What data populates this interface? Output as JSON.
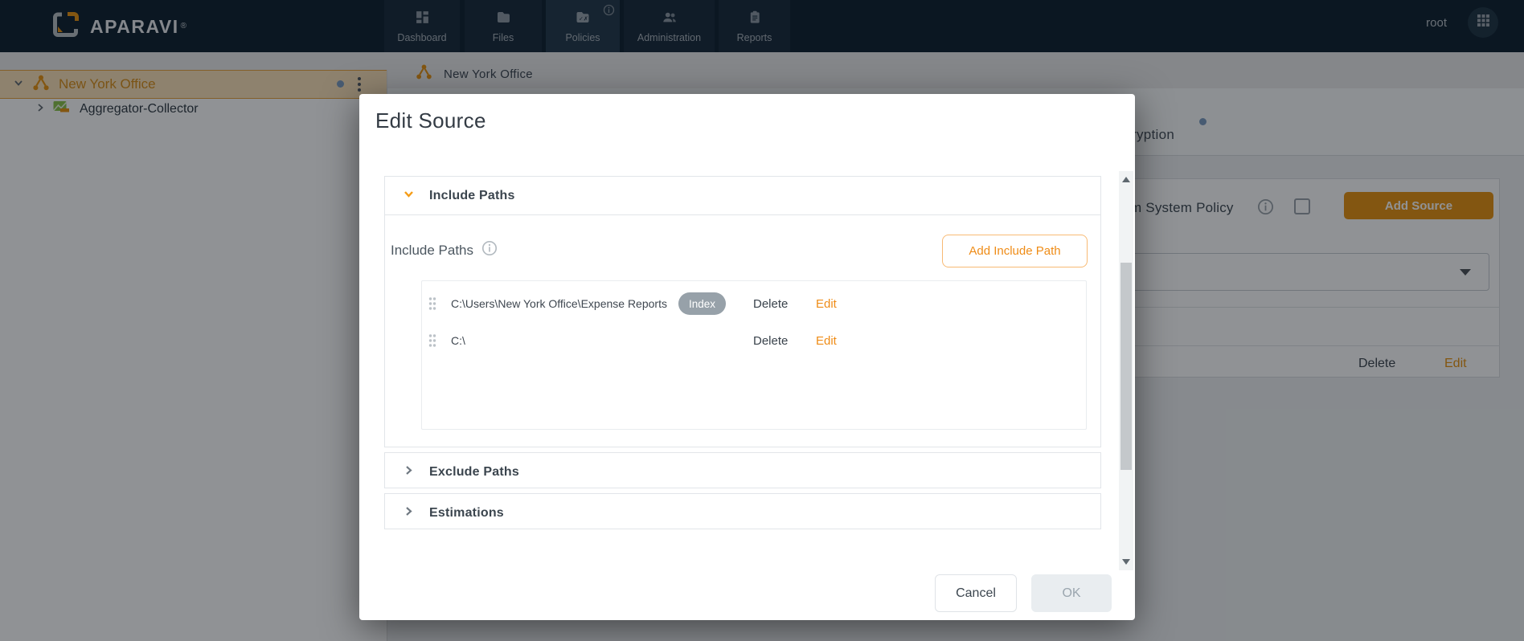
{
  "brand": {
    "wordmark": "APARAVI",
    "registered": "®"
  },
  "navbar": {
    "items": [
      {
        "label": "Dashboard",
        "icon": "dashboard-icon",
        "active": false
      },
      {
        "label": "Files",
        "icon": "folder-icon",
        "active": false
      },
      {
        "label": "Policies",
        "icon": "policies-folder-icon",
        "active": true,
        "has_info_icon": true
      },
      {
        "label": "Administration",
        "icon": "people-icon",
        "active": false
      },
      {
        "label": "Reports",
        "icon": "clipboard-icon",
        "active": false
      }
    ],
    "username": "root"
  },
  "sidebar": {
    "selected_node": {
      "label": "New York Office",
      "expanded": true,
      "has_status_dot": true
    },
    "child_node": {
      "label": "Aggregator-Collector",
      "expanded": false
    }
  },
  "breadcrumb": {
    "label": "New York Office"
  },
  "background_page": {
    "tab_label_partial": "ryption",
    "policy_label_partial": "m System Policy",
    "add_source_button": "Add Source",
    "row_actions": {
      "delete": "Delete",
      "edit": "Edit"
    }
  },
  "modal": {
    "title": "Edit Source",
    "include_section": {
      "header": "Include Paths",
      "field_label": "Include Paths",
      "add_button": "Add Include Path",
      "rows": [
        {
          "path": "C:\\Users\\New York Office\\Expense Reports",
          "badge": "Index",
          "delete_label": "Delete",
          "edit_label": "Edit"
        },
        {
          "path": "C:\\",
          "delete_label": "Delete",
          "edit_label": "Edit"
        }
      ]
    },
    "exclude_section": {
      "header": "Exclude Paths"
    },
    "estimations_section": {
      "header": "Estimations"
    },
    "footer": {
      "cancel_label": "Cancel",
      "ok_label": "OK"
    }
  },
  "colors": {
    "navbar_bg": "#0d1f2e",
    "brand_orange": "#e8930f",
    "accent_orange": "#ef8c17",
    "selected_row_bg": "#fbe2b9",
    "badge_gray": "#97a1a9",
    "status_dot_blue": "#7b9cc0"
  }
}
